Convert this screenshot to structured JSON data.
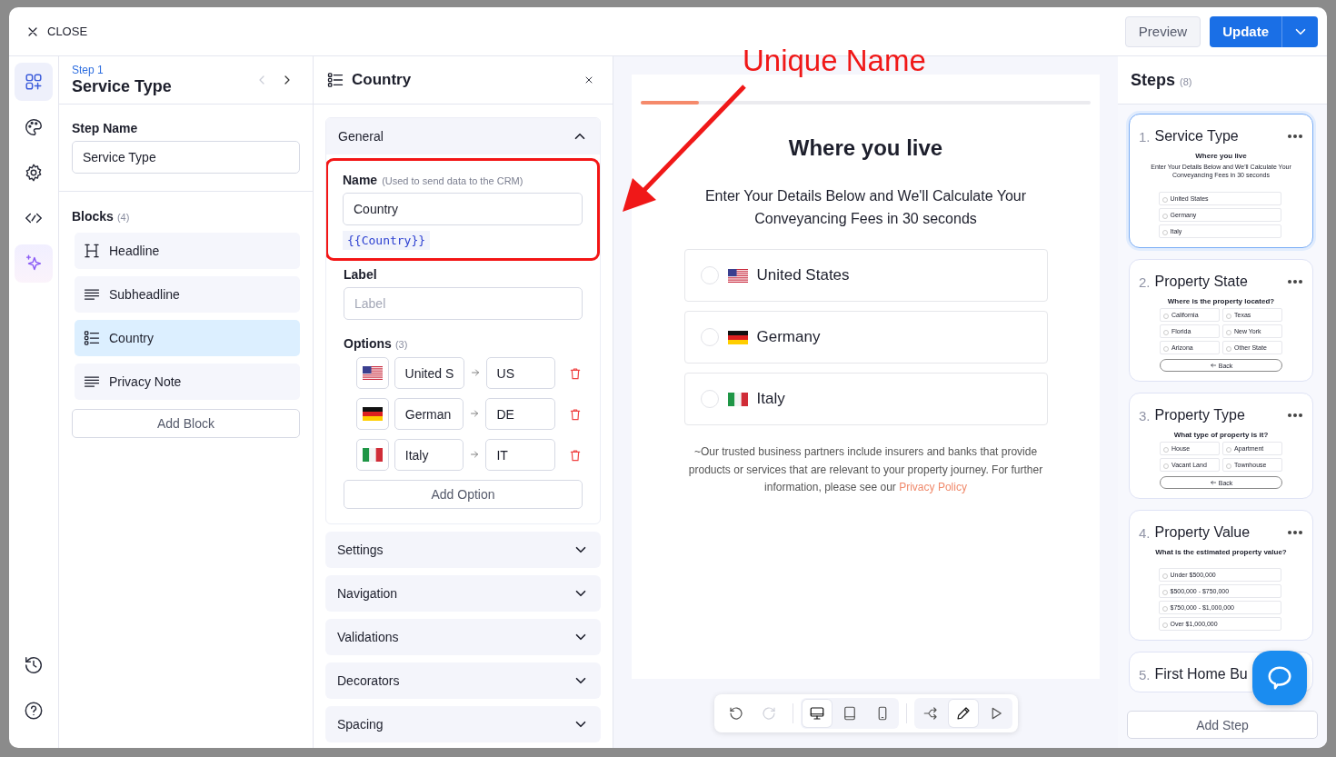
{
  "header": {
    "close": "CLOSE",
    "preview": "Preview",
    "update": "Update"
  },
  "rail": {
    "items": [
      {
        "kind": "blocks",
        "selected": true
      },
      {
        "kind": "theme",
        "selected": false
      },
      {
        "kind": "settings",
        "selected": false
      },
      {
        "kind": "code",
        "selected": false
      },
      {
        "kind": "ai",
        "selected": false
      }
    ],
    "bottom": [
      {
        "kind": "history"
      },
      {
        "kind": "help"
      }
    ]
  },
  "step_panel": {
    "step_label": "Step 1",
    "title": "Service Type",
    "prev_disabled": true,
    "step_name_label": "Step Name",
    "step_name": "Service Type",
    "blocks_label": "Blocks",
    "blocks_count": "(4)",
    "blocks": [
      {
        "kind": "heading",
        "label": "Headline",
        "selected": false
      },
      {
        "kind": "text",
        "label": "Subheadline",
        "selected": false
      },
      {
        "kind": "list",
        "label": "Country",
        "selected": true
      },
      {
        "kind": "text",
        "label": "Privacy Note",
        "selected": false
      }
    ],
    "add_block": "Add Block"
  },
  "block_editor": {
    "title": "Country",
    "sections": [
      {
        "label": "General",
        "expanded": true
      },
      {
        "label": "Settings",
        "expanded": false
      },
      {
        "label": "Navigation",
        "expanded": false
      },
      {
        "label": "Validations",
        "expanded": false
      },
      {
        "label": "Decorators",
        "expanded": false
      },
      {
        "label": "Spacing",
        "expanded": false
      }
    ],
    "general": {
      "highlighted": true,
      "name_label": "Name",
      "name_hint": "(Used to send data to the CRM)",
      "name_value": "Country",
      "variable": "{{Country}}",
      "label_label": "Label",
      "label_placeholder": "Label",
      "options_label": "Options",
      "options_count": "(3)",
      "options": [
        {
          "kind": "us",
          "label": "United S",
          "value": "US"
        },
        {
          "kind": "de",
          "label": "German",
          "value": "DE"
        },
        {
          "kind": "it",
          "label": "Italy",
          "value": "IT"
        }
      ],
      "add_option": "Add Option"
    }
  },
  "preview": {
    "progress": {
      "level": 0.13
    },
    "heading": "Where you live",
    "subheading": "Enter Your Details Below and We'll Calculate Your Conveyancing Fees in 30 seconds",
    "options": [
      {
        "kind": "us",
        "label": "United States",
        "selected": false
      },
      {
        "kind": "de",
        "label": "Germany",
        "selected": false
      },
      {
        "kind": "it",
        "label": "Italy",
        "selected": false
      }
    ],
    "note": "~Our trusted business partners include insurers and banks that provide products or services that are relevant to your property journey. For further information, please see our",
    "link": "Privacy Policy"
  },
  "toolbar": {
    "groups": [
      {
        "items": [
          {
            "kind": "undo",
            "selected": false,
            "disabled": false
          },
          {
            "kind": "redo",
            "selected": false,
            "disabled": true
          }
        ]
      },
      {
        "items": [
          {
            "kind": "desktop",
            "selected": true,
            "disabled": false
          },
          {
            "kind": "tablet",
            "selected": false,
            "disabled": false
          },
          {
            "kind": "mobile",
            "selected": false,
            "disabled": false
          }
        ]
      },
      {
        "items": [
          {
            "kind": "flow",
            "selected": false,
            "disabled": false
          },
          {
            "kind": "edit",
            "selected": true,
            "disabled": false
          },
          {
            "kind": "play",
            "selected": false,
            "disabled": false
          }
        ]
      }
    ]
  },
  "steps": {
    "title": "Steps",
    "count": "(8)",
    "add_step": "Add Step",
    "items": [
      {
        "number": "1.",
        "title": "Service Type",
        "selected": true,
        "preview": {
          "kind": "list",
          "heading": "Where you live",
          "subheading": "Enter Your Details Below and We'll Calculate Your Conveyancing Fees in 30 seconds",
          "options": [
            "United States",
            "Germany",
            "Italy"
          ]
        }
      },
      {
        "number": "2.",
        "title": "Property State",
        "selected": false,
        "preview": {
          "kind": "grid",
          "heading": "Where is the property located?",
          "options": [
            "California",
            "Texas",
            "Florida",
            "New York",
            "Arizona",
            "Other State"
          ],
          "back": "Back"
        }
      },
      {
        "number": "3.",
        "title": "Property Type",
        "selected": false,
        "preview": {
          "kind": "grid",
          "heading": "What type of property is it?",
          "options": [
            "House",
            "Apartment",
            "Vacant Land",
            "Townhouse"
          ],
          "back": "Back"
        }
      },
      {
        "number": "4.",
        "title": "Property Value",
        "selected": false,
        "preview": {
          "kind": "list",
          "heading": "What is the estimated property value?",
          "options": [
            "Under $500,000",
            "$500,000 - $750,000",
            "$750,000 - $1,000,000",
            "Over $1,000,000"
          ]
        }
      },
      {
        "number": "5.",
        "title": "First Home Bu",
        "selected": false
      }
    ]
  },
  "annotation": {
    "text": "Unique Name"
  }
}
